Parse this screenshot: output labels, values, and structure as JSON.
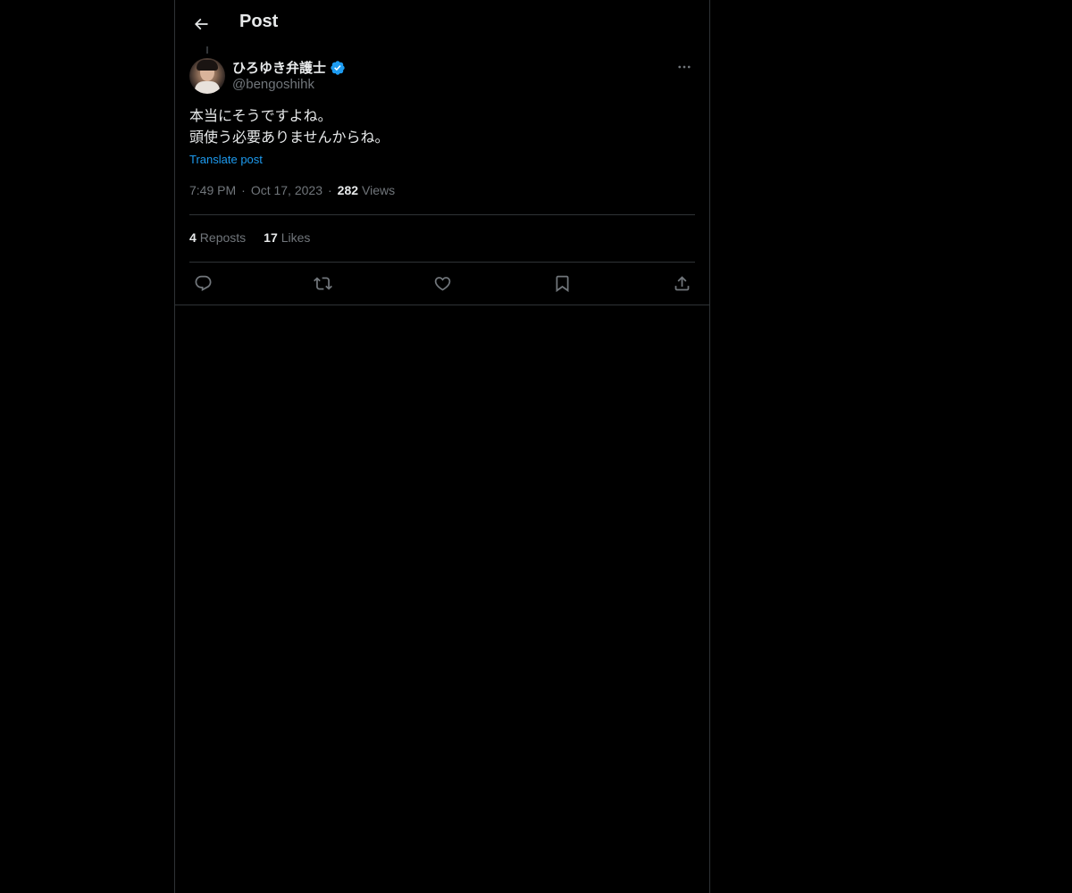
{
  "header": {
    "title": "Post",
    "back_icon": "arrow-left-icon"
  },
  "author": {
    "display_name": "ひろゆき弁護士",
    "handle": "@bengoshihk",
    "verified": true,
    "verified_color": "#1d9bf0"
  },
  "tweet": {
    "lines": [
      "本当にそうですよね。",
      "頭使う必要ありませんからね。"
    ],
    "translate_label": "Translate post"
  },
  "meta": {
    "time": "7:49 PM",
    "separator": "·",
    "date": "Oct 17, 2023",
    "views_count": "282",
    "views_label": "Views"
  },
  "stats": {
    "reposts_count": "4",
    "reposts_label": "Reposts",
    "likes_count": "17",
    "likes_label": "Likes"
  },
  "actions": [
    "reply-icon",
    "repost-icon",
    "like-icon",
    "bookmark-icon",
    "share-icon"
  ],
  "colors": {
    "background": "#000000",
    "text": "#e7e9ea",
    "muted": "#71767b",
    "accent": "#1d9bf0",
    "border": "#2f3336"
  }
}
